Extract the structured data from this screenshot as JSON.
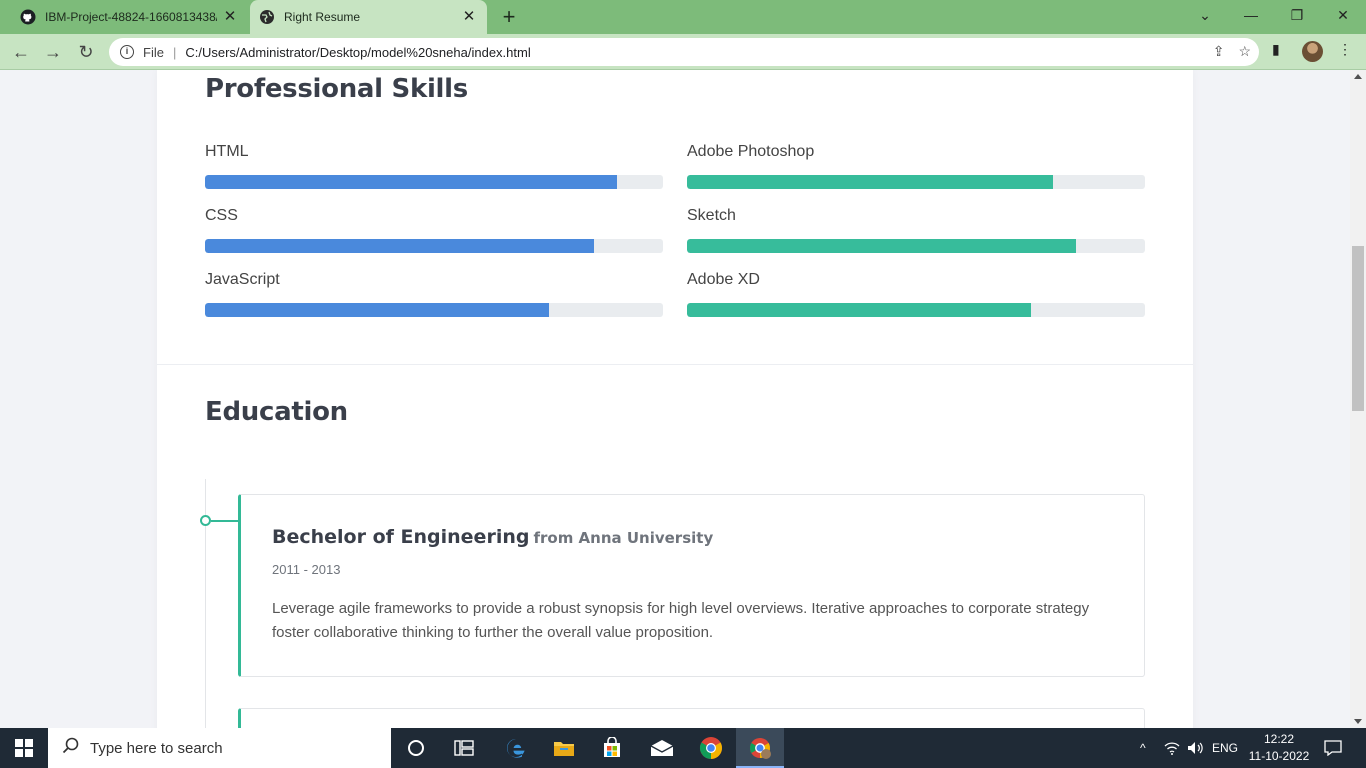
{
  "browser": {
    "tabs": [
      {
        "label": "IBM-Project-48824-1660813438/",
        "icon": "github-icon",
        "active": false
      },
      {
        "label": "Right Resume",
        "icon": "globe-icon",
        "active": true
      }
    ],
    "new_tab_label": "+",
    "address": {
      "scheme_label": "File",
      "url": "C:/Users/Administrator/Desktop/model%20sneha/index.html"
    }
  },
  "resume": {
    "skills_title": "Professional Skills",
    "skills": [
      {
        "name": "HTML",
        "level": 0.9,
        "color": "#4a89dc"
      },
      {
        "name": "Adobe Photoshop",
        "level": 0.8,
        "color": "#37bc9b"
      },
      {
        "name": "CSS",
        "level": 0.85,
        "color": "#4a89dc"
      },
      {
        "name": "Sketch",
        "level": 0.85,
        "color": "#37bc9b"
      },
      {
        "name": "JavaScript",
        "level": 0.75,
        "color": "#4a89dc"
      },
      {
        "name": "Adobe XD",
        "level": 0.75,
        "color": "#37bc9b"
      }
    ],
    "education_title": "Education",
    "education": [
      {
        "degree": "Bechelor of Engineering",
        "institution": "from Anna University",
        "years": "2011 - 2013",
        "description": "Leverage agile frameworks to provide a robust synopsis for high level overviews. Iterative approaches to corporate strategy foster collaborative thinking to further the overall value proposition."
      }
    ]
  },
  "taskbar": {
    "search_placeholder": "Type here to search",
    "language": "ENG",
    "time": "12:22",
    "date": "11-10-2022"
  },
  "colors": {
    "accent_green": "#37bc9b",
    "accent_blue": "#4a89dc",
    "browser_frame": "#7dbb7a"
  }
}
